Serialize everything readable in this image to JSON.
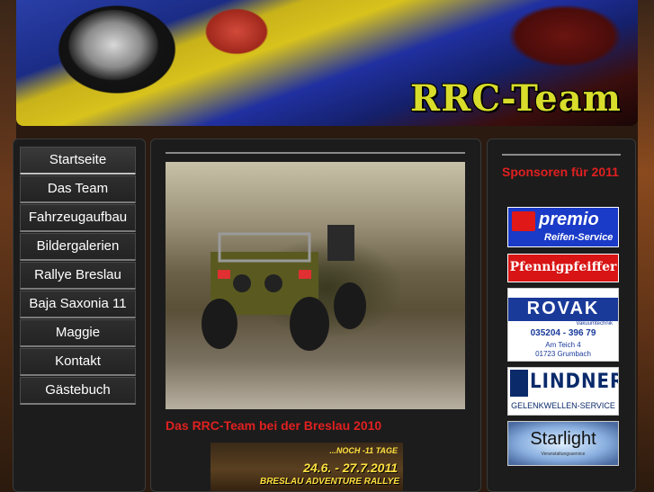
{
  "header": {
    "title": "RRC-Team"
  },
  "nav": {
    "items": [
      {
        "label": "Startseite",
        "active": true
      },
      {
        "label": "Das Team"
      },
      {
        "label": "Fahrzeugaufbau"
      },
      {
        "label": "Bildergalerien"
      },
      {
        "label": "Rallye Breslau"
      },
      {
        "label": "Baja Saxonia 11"
      },
      {
        "label": "Maggie"
      },
      {
        "label": "Kontakt"
      },
      {
        "label": "Gästebuch"
      }
    ]
  },
  "main": {
    "caption": "Das RRC-Team bei der Breslau 2010",
    "teaser": {
      "countdown": "...NOCH -11 TAGE",
      "dates": "24.6. - 27.7.2011",
      "event": "BRESLAU ADVENTURE RALLYE"
    }
  },
  "sidebar": {
    "heading": "Sponsoren für 2011",
    "sponsors": {
      "premio": {
        "name": "premio",
        "tagline": "Reifen-Service"
      },
      "pfennig": {
        "name": "Pfennigpfeiffer"
      },
      "rovak": {
        "name": "ROVAK",
        "subtitle": "Vakuumtechnik",
        "phone": "035204 - 396 79",
        "address1": "Am Teich 4",
        "address2": "01723 Grumbach"
      },
      "lindner": {
        "name": "LINDNER",
        "tagline": "GELENKWELLEN-SERVICE"
      },
      "starlight": {
        "name": "Starlight",
        "tagline": "Veranstaltungsservice"
      }
    }
  },
  "colors": {
    "accent_red": "#e02020",
    "title_yellow": "#d8dc2a",
    "panel_bg": "#1c1c1c"
  }
}
